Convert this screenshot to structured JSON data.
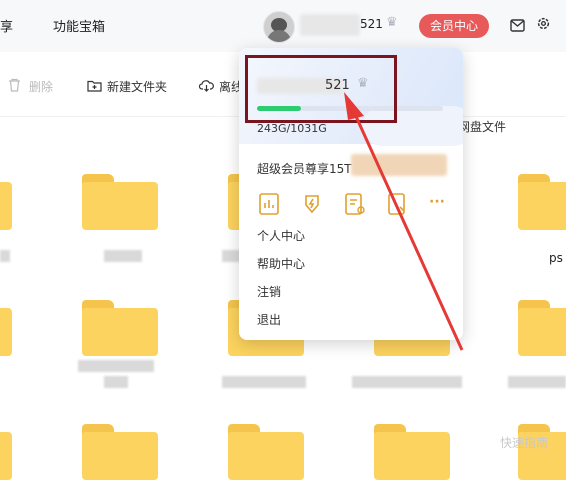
{
  "topbar": {
    "nav_items": [
      "享",
      "功能宝箱"
    ],
    "username_suffix": "521",
    "vip_button": "会员中心"
  },
  "toolbar": {
    "delete_label": "删除",
    "new_folder_label": "新建文件夹",
    "offline_label": "离线",
    "right_label": "网盘文件"
  },
  "files": {
    "partial_label": "ps"
  },
  "dropdown": {
    "username_suffix": "521",
    "storage_text": "243G/1031G",
    "storage_used_fraction": 0.236,
    "vip_text": "超级会员尊享15T",
    "icons": [
      "report-icon",
      "lightning-download-icon",
      "document-icon",
      "file-scan-icon",
      "more-icon"
    ],
    "more_label": "···",
    "menu_items": [
      "个人中心",
      "帮助中心",
      "注销",
      "退出"
    ]
  },
  "annotation": {
    "color": "#e53935",
    "box_color": "#7a1520"
  },
  "watermark": {
    "text": "快速指南"
  },
  "colors": {
    "vip_button": "#e85a5a",
    "folder": "#fcd35e",
    "storage_fill": "#2ecc71"
  }
}
